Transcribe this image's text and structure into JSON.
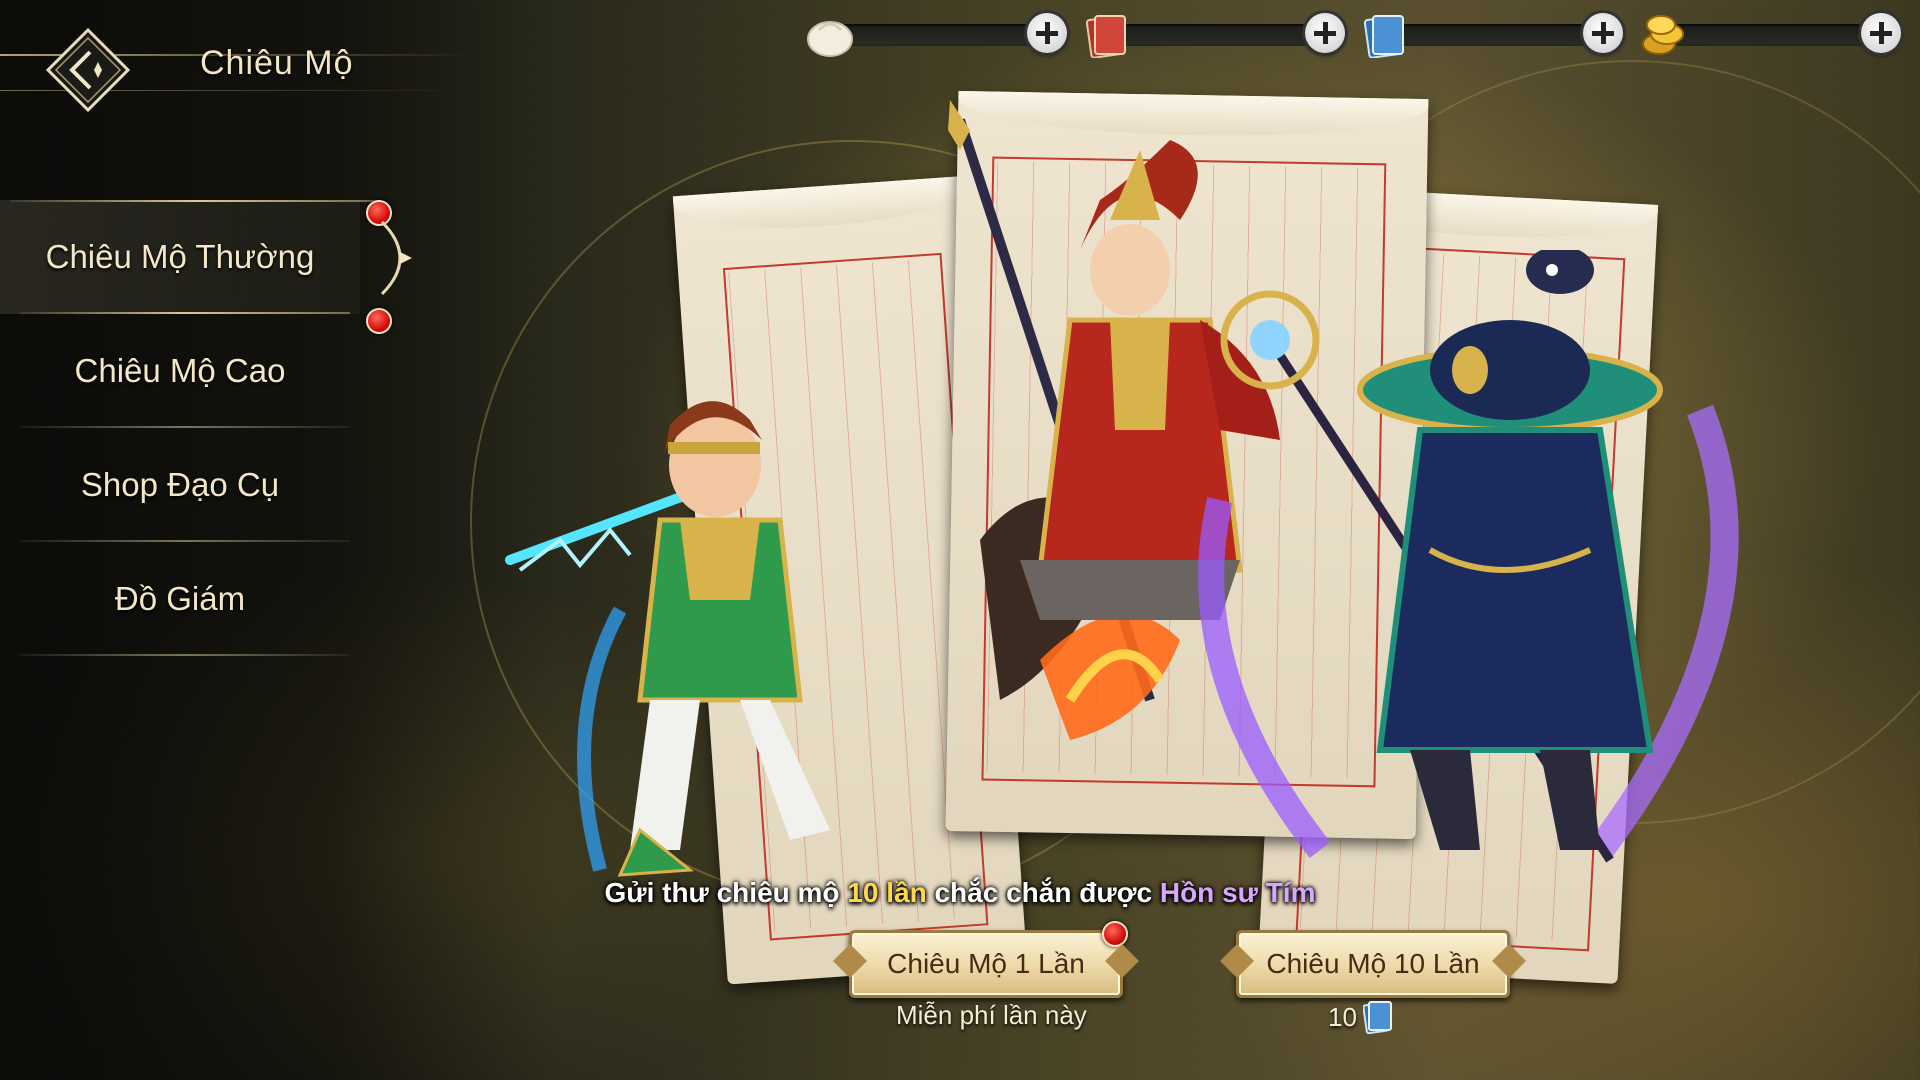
{
  "header": {
    "title": "Chiêu Mộ",
    "back_icon": "back-arrow-icon"
  },
  "currencies": [
    {
      "icon": "bun-icon",
      "value": ""
    },
    {
      "icon": "red-letter-icon",
      "value": ""
    },
    {
      "icon": "blue-letter-icon",
      "value": ""
    },
    {
      "icon": "gold-coin-icon",
      "value": ""
    }
  ],
  "sidebar": {
    "items": [
      {
        "label": "Chiêu Mộ Thường",
        "active": true,
        "badge": true
      },
      {
        "label": "Chiêu Mộ Cao",
        "active": false,
        "badge": true
      },
      {
        "label": "Shop Đạo Cụ",
        "active": false,
        "badge": false
      },
      {
        "label": "Đồ Giám",
        "active": false,
        "badge": false
      }
    ]
  },
  "banner": {
    "part1": "Gửi thư chiêu mộ ",
    "part2": "10 lần",
    "part3": " chắc chắn được ",
    "part4": "Hồn sư Tím",
    "highlight_color": "#ffd84a",
    "purple_color": "#d9a6ff"
  },
  "actions": {
    "single": {
      "label": "Chiêu Mộ 1 Lần",
      "sub": "Miễn phí lần này",
      "badge": true
    },
    "ten": {
      "label": "Chiêu Mộ 10 Lần",
      "cost": "10",
      "cost_icon": "blue-letter-icon"
    }
  },
  "heroes": [
    "green-warrior-hero",
    "red-spear-hero",
    "purple-mage-hero"
  ]
}
